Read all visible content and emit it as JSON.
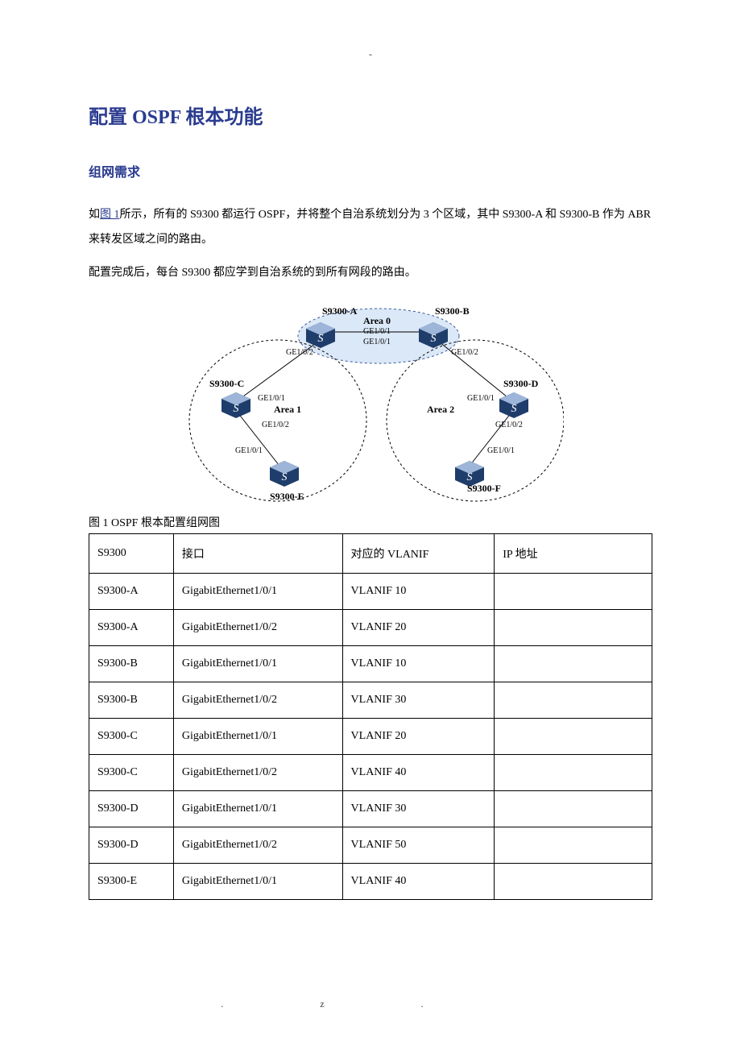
{
  "top_dash": "-",
  "title": "配置 OSPF 根本功能",
  "section1": {
    "heading": "组网需求"
  },
  "para1_a": "如",
  "para1_link": "图 1",
  "para1_b": "所示，所有的 S9300 都运行 OSPF，并将整个自治系统划分为 3 个区域，其中 S9300-A 和 S9300-B 作为 ABR 来转发区域之间的路由。",
  "para2": "配置完成后，每台 S9300 都应学到自治系统的到所有网段的路由。",
  "diagram": {
    "labels": {
      "s9300a": "S9300-A",
      "s9300b": "S9300-B",
      "s9300c": "S9300-C",
      "s9300d": "S9300-D",
      "s9300e": "S9300-E",
      "s9300f": "S9300-F",
      "area0": "Area 0",
      "area1": "Area 1",
      "area2": "Area 2",
      "ge101": "GE1/0/1",
      "ge102": "GE1/0/2",
      "switch_letter": "S"
    }
  },
  "caption": "图 1 OSPF 根本配置组网图",
  "table": {
    "headers": [
      "S9300",
      "接口",
      "对应的 VLANIF",
      "IP 地址"
    ],
    "rows": [
      [
        "S9300-A",
        "GigabitEthernet1/0/1",
        "VLANIF 10",
        ""
      ],
      [
        "S9300-A",
        "GigabitEthernet1/0/2",
        "VLANIF 20",
        ""
      ],
      [
        "S9300-B",
        "GigabitEthernet1/0/1",
        "VLANIF 10",
        ""
      ],
      [
        "S9300-B",
        "GigabitEthernet1/0/2",
        "VLANIF 30",
        ""
      ],
      [
        "S9300-C",
        "GigabitEthernet1/0/1",
        "VLANIF 20",
        ""
      ],
      [
        "S9300-C",
        "GigabitEthernet1/0/2",
        "VLANIF 40",
        ""
      ],
      [
        "S9300-D",
        "GigabitEthernet1/0/1",
        "VLANIF 30",
        ""
      ],
      [
        "S9300-D",
        "GigabitEthernet1/0/2",
        "VLANIF 50",
        ""
      ],
      [
        "S9300-E",
        "GigabitEthernet1/0/1",
        "VLANIF 40",
        ""
      ]
    ]
  },
  "footer_left": ".",
  "footer_right": "z."
}
